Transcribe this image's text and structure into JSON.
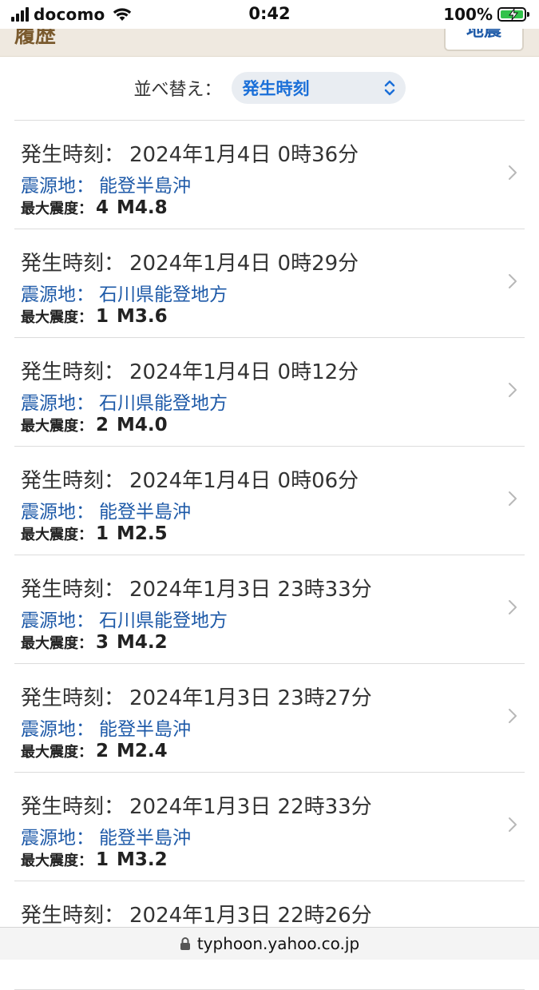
{
  "status_bar": {
    "carrier": "docomo",
    "time": "0:42",
    "battery_percent": "100%",
    "battery_level": 1.0,
    "signal_bars": 4,
    "icons": [
      "signal-icon",
      "wifi-icon",
      "battery-charging-icon"
    ]
  },
  "tab_strip": {
    "title_partial": "履歴",
    "quake_tab": "地震"
  },
  "sort": {
    "label": "並べ替え：",
    "selected": "発生時刻"
  },
  "labels": {
    "time": "発生時刻：",
    "epicenter": "震源地：",
    "max_intensity": "最大震度："
  },
  "quakes": [
    {
      "time": "2024年1月4日 0時36分",
      "epicenter": "能登半島沖",
      "intensity": "4",
      "magnitude": "M4.8"
    },
    {
      "time": "2024年1月4日 0時29分",
      "epicenter": "石川県能登地方",
      "intensity": "1",
      "magnitude": "M3.6"
    },
    {
      "time": "2024年1月4日 0時12分",
      "epicenter": "石川県能登地方",
      "intensity": "2",
      "magnitude": "M4.0"
    },
    {
      "time": "2024年1月4日 0時06分",
      "epicenter": "能登半島沖",
      "intensity": "1",
      "magnitude": "M2.5"
    },
    {
      "time": "2024年1月3日 23時33分",
      "epicenter": "石川県能登地方",
      "intensity": "3",
      "magnitude": "M4.2"
    },
    {
      "time": "2024年1月3日 23時27分",
      "epicenter": "能登半島沖",
      "intensity": "2",
      "magnitude": "M2.4"
    },
    {
      "time": "2024年1月3日 22時33分",
      "epicenter": "能登半島沖",
      "intensity": "1",
      "magnitude": "M3.2"
    },
    {
      "time": "2024年1月3日 22時26分",
      "epicenter": "",
      "intensity": "",
      "magnitude": ""
    }
  ],
  "url_bar": {
    "url": "typhoon.yahoo.co.jp"
  },
  "colors": {
    "link_blue": "#1e5aa8",
    "sort_blue": "#1a6fd8",
    "battery_green": "#32c24a",
    "tab_strip_bg": "#efe9e0"
  }
}
